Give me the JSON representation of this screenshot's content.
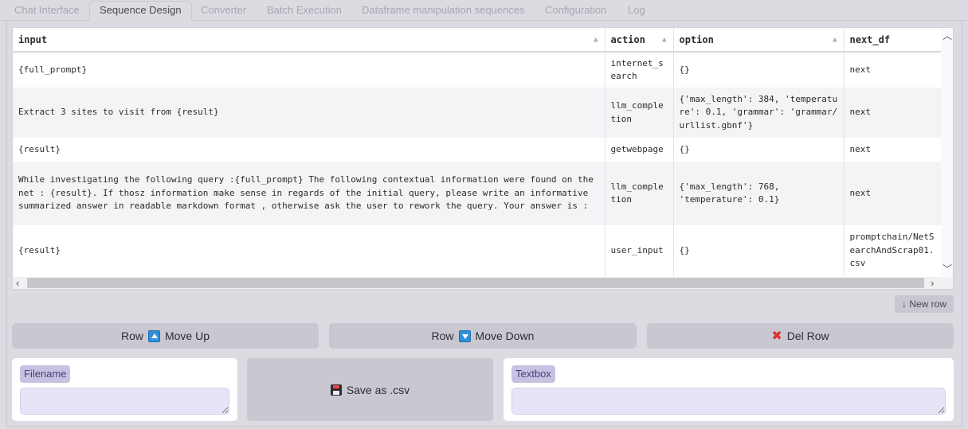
{
  "tabs": [
    {
      "label": "Chat Interface",
      "active": false
    },
    {
      "label": "Sequence Design",
      "active": true
    },
    {
      "label": "Converter",
      "active": false
    },
    {
      "label": "Batch Execution",
      "active": false
    },
    {
      "label": "Dataframe manipulation sequences",
      "active": false
    },
    {
      "label": "Configuration",
      "active": false
    },
    {
      "label": "Log",
      "active": false
    }
  ],
  "table": {
    "columns": [
      "input",
      "action",
      "option",
      "next_df"
    ],
    "rows": [
      {
        "input": "{full_prompt}",
        "action": "internet_search",
        "option": "{}",
        "next_df": "next"
      },
      {
        "input": "Extract 3 sites to visit from {result}",
        "action": "llm_completion",
        "option": "{'max_length': 384, 'temperature': 0.1, 'grammar': 'grammar/urllist.gbnf'}",
        "next_df": "next"
      },
      {
        "input": "{result}",
        "action": "getwebpage",
        "option": "{}",
        "next_df": "next"
      },
      {
        "input": "While investigating the following query :{full_prompt} The following contextual information were found on the net : {result}. If thosz information make sense in regards of the initial query, please write an informative summarized answer in readable markdown format , otherwise ask the user to rework the query. Your answer is :",
        "action": "llm_completion",
        "option": "{'max_length': 768, 'temperature': 0.1}",
        "next_df": "next"
      },
      {
        "input": "{result}",
        "action": "user_input",
        "option": "{}",
        "next_df": "promptchain/NetSearchAndScrap01.csv"
      }
    ]
  },
  "new_row_label": "↓ New row",
  "buttons": {
    "move_up_pre": "Row",
    "move_up_post": "Move Up",
    "move_down_pre": "Row",
    "move_down_post": "Move Down",
    "del_row": "Del Row",
    "save_csv": "Save as .csv"
  },
  "filename": {
    "label": "Filename",
    "value": ""
  },
  "textbox": {
    "label": "Textbox",
    "value": ""
  },
  "icons": {
    "move_up": "arrow-up-square-icon",
    "move_down": "arrow-down-square-icon",
    "del_row": "red-x-icon",
    "save": "floppy-disk-icon"
  }
}
